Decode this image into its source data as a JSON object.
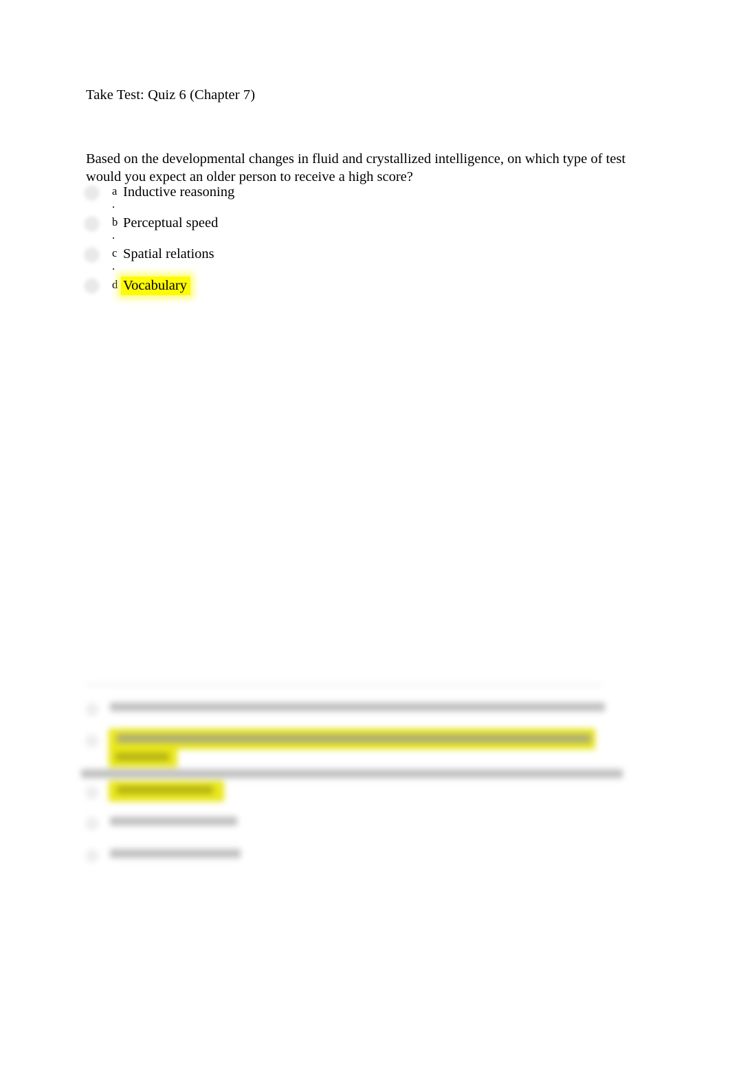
{
  "document": {
    "title": "Take Test: Quiz 6 (Chapter 7)",
    "page_background": "#ffffff",
    "text_color": "#000000",
    "highlight_color": "#fdfb06"
  },
  "question": {
    "text": "Based on the developmental changes in fluid and crystallized intelligence, on which type of test would you expect an older person to receive a high score?",
    "options": [
      {
        "letter": "a",
        "period": ".",
        "label": "Inductive reasoning",
        "highlighted": false
      },
      {
        "letter": "b",
        "period": ".",
        "label": "Perceptual speed",
        "highlighted": false
      },
      {
        "letter": "c",
        "period": ".",
        "label": "Spatial relations",
        "highlighted": false
      },
      {
        "letter": "d",
        "period": "",
        "label": "Vocabulary",
        "highlighted": true
      }
    ]
  },
  "blurred_section": {
    "note": "Lower portion of the page is out of focus / illegible",
    "divider_color": "#cfcfcf",
    "highlight_color": "#e9e71a",
    "text_color": "#9a9a9a"
  }
}
